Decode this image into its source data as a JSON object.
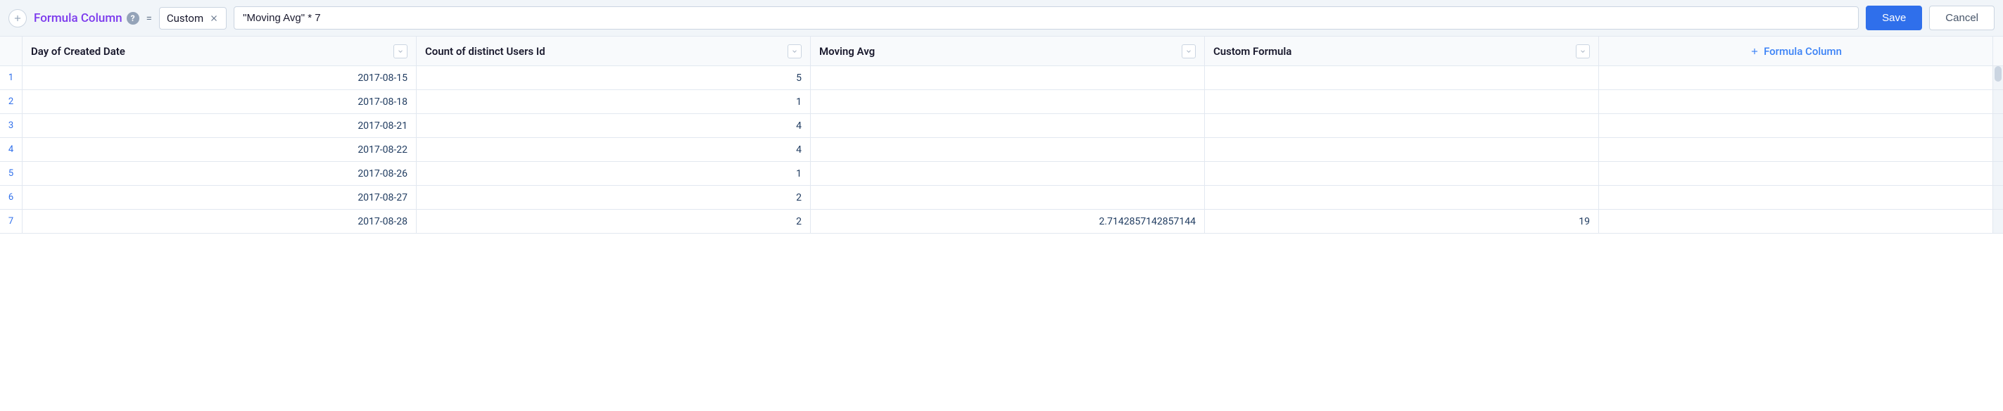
{
  "formula_bar": {
    "title": "Formula Column",
    "equals": "=",
    "type_label": "Custom",
    "expression": "\"Moving Avg\" * 7",
    "save_label": "Save",
    "cancel_label": "Cancel"
  },
  "grid": {
    "columns": [
      {
        "label": "Day of Created Date",
        "align": "right"
      },
      {
        "label": "Count of distinct Users Id",
        "align": "right"
      },
      {
        "label": "Moving Avg",
        "align": "right"
      },
      {
        "label": "Custom Formula",
        "align": "right"
      }
    ],
    "add_column_label": "Formula Column",
    "rows": [
      {
        "num": "1",
        "cells": [
          "2017-08-15",
          "5",
          "",
          ""
        ]
      },
      {
        "num": "2",
        "cells": [
          "2017-08-18",
          "1",
          "",
          ""
        ]
      },
      {
        "num": "3",
        "cells": [
          "2017-08-21",
          "4",
          "",
          ""
        ]
      },
      {
        "num": "4",
        "cells": [
          "2017-08-22",
          "4",
          "",
          ""
        ]
      },
      {
        "num": "5",
        "cells": [
          "2017-08-26",
          "1",
          "",
          ""
        ]
      },
      {
        "num": "6",
        "cells": [
          "2017-08-27",
          "2",
          "",
          ""
        ]
      },
      {
        "num": "7",
        "cells": [
          "2017-08-28",
          "2",
          "2.7142857142857144",
          "19"
        ]
      }
    ]
  }
}
